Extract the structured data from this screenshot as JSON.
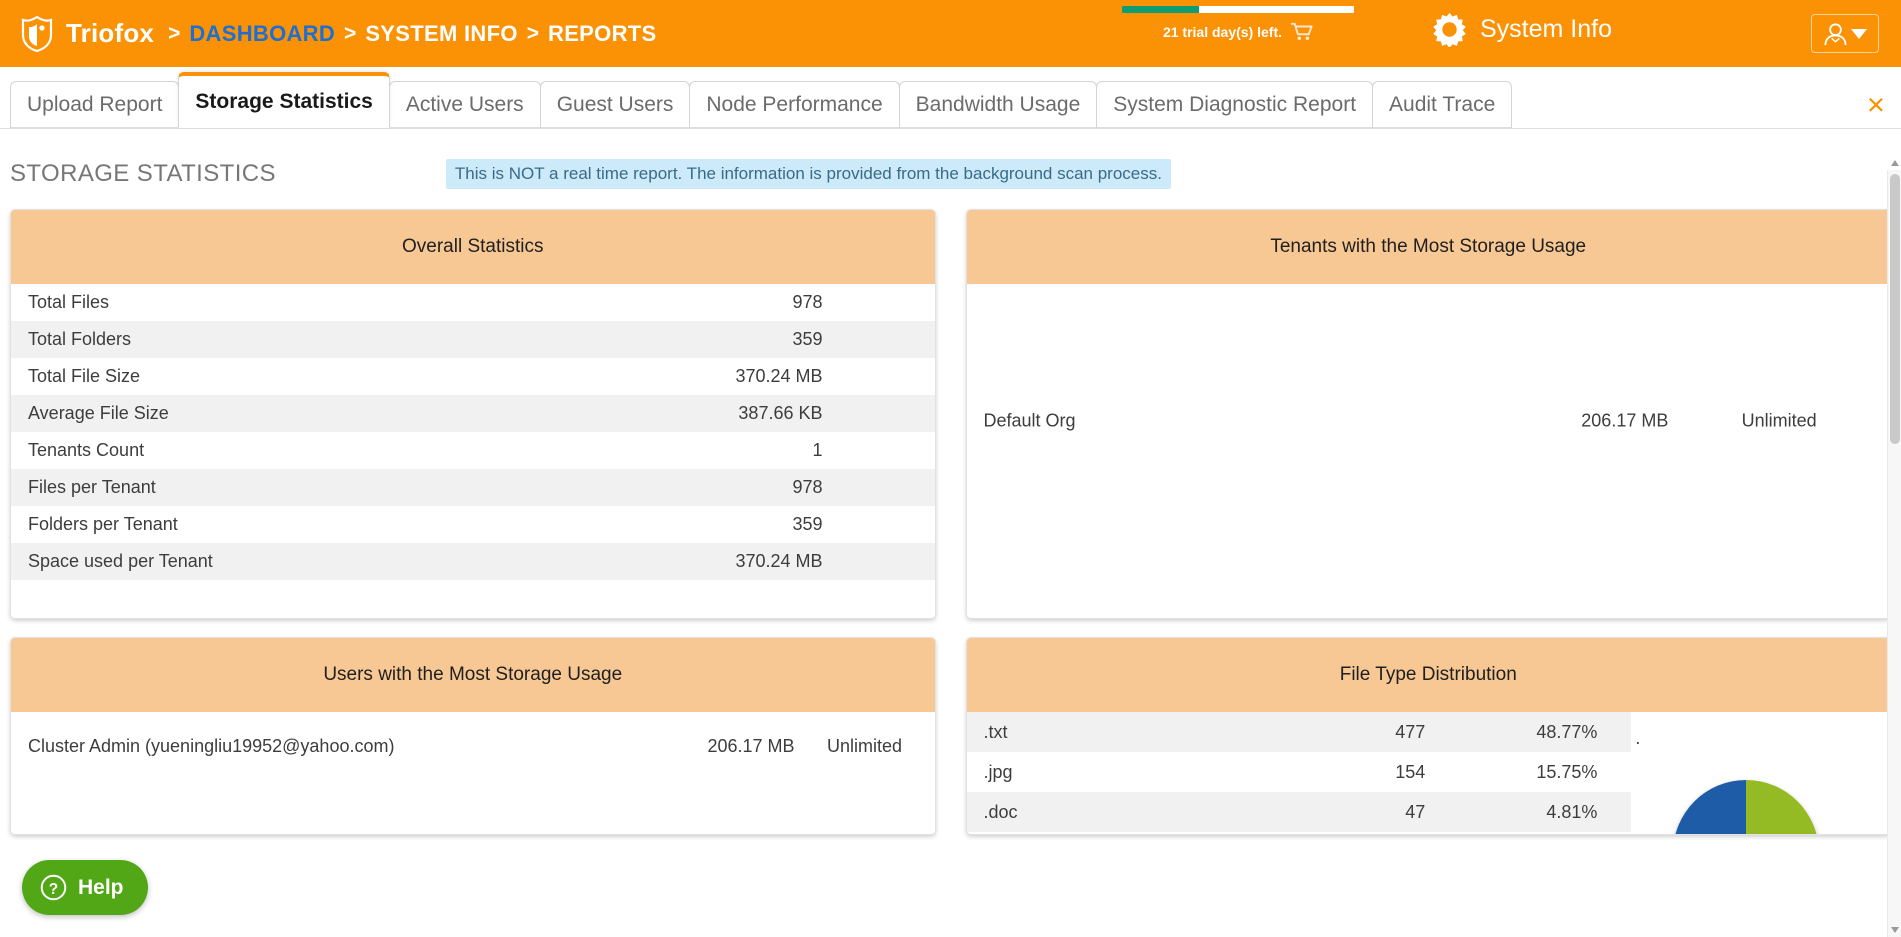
{
  "header": {
    "brand": "Triofox",
    "breadcrumb": [
      {
        "label": "DASHBOARD",
        "active": true
      },
      {
        "label": "SYSTEM INFO",
        "active": false
      },
      {
        "label": "REPORTS",
        "active": false
      }
    ],
    "separator": ">",
    "trial_text": "21 trial day(s) left.",
    "trial_percent": 33,
    "system_info_label": "System Info",
    "logo_icon": "shield-logo-icon",
    "cart_icon": "shopping-cart-icon",
    "gear_icon": "gear-icon",
    "user_icon": "user-avatar-icon",
    "caret_icon": "chevron-down-icon",
    "accent_color": "#fb9104",
    "breadcrumb_active_color": "#1d6fd0",
    "trial_bar_fill_color": "#0f9d74"
  },
  "tabs": [
    {
      "label": "Upload Report",
      "active": false
    },
    {
      "label": "Storage Statistics",
      "active": true
    },
    {
      "label": "Active Users",
      "active": false
    },
    {
      "label": "Guest Users",
      "active": false
    },
    {
      "label": "Node Performance",
      "active": false
    },
    {
      "label": "Bandwidth Usage",
      "active": false
    },
    {
      "label": "System Diagnostic Report",
      "active": false
    },
    {
      "label": "Audit Trace",
      "active": false
    }
  ],
  "tab_close_glyph": "×",
  "page": {
    "title": "STORAGE STATISTICS",
    "notice": "This is NOT a real time report. The information is provided from the background scan process."
  },
  "cards": {
    "overall": {
      "title": "Overall Statistics",
      "rows": [
        {
          "label": "Total Files",
          "value": "978"
        },
        {
          "label": "Total Folders",
          "value": "359"
        },
        {
          "label": "Total File Size",
          "value": "370.24 MB"
        },
        {
          "label": "Average File Size",
          "value": "387.66 KB"
        },
        {
          "label": "Tenants Count",
          "value": "1"
        },
        {
          "label": "Files per Tenant",
          "value": "978"
        },
        {
          "label": "Folders per Tenant",
          "value": "359"
        },
        {
          "label": "Space used per Tenant",
          "value": "370.24 MB"
        }
      ]
    },
    "tenants": {
      "title": "Tenants with the Most Storage Usage",
      "rows": [
        {
          "name": "Default Org",
          "usage": "206.17 MB",
          "quota": "Unlimited"
        }
      ]
    },
    "users": {
      "title": "Users with the Most Storage Usage",
      "rows": [
        {
          "name": "Cluster Admin (yueningliu19952@yahoo.com)",
          "usage": "206.17 MB",
          "quota": "Unlimited"
        }
      ]
    },
    "filetypes": {
      "title": "File Type Distribution",
      "marker": ".",
      "rows": [
        {
          "ext": ".txt",
          "count": "477",
          "percent": "48.77%"
        },
        {
          "ext": ".jpg",
          "count": "154",
          "percent": "15.75%"
        },
        {
          "ext": ".doc",
          "count": "47",
          "percent": "4.81%"
        }
      ]
    }
  },
  "chart_data": {
    "type": "pie",
    "title": "File Type Distribution",
    "labels": [
      ".txt",
      ".jpg",
      ".doc"
    ],
    "values": [
      477,
      154,
      47
    ],
    "percents": [
      48.77,
      15.75,
      4.81
    ],
    "colors": [
      "#94ba24",
      "#1f5ca8",
      "#e0b02a"
    ],
    "legend": "none"
  },
  "help": {
    "label": "Help",
    "icon": "question-circle-icon",
    "color": "#51a715"
  }
}
